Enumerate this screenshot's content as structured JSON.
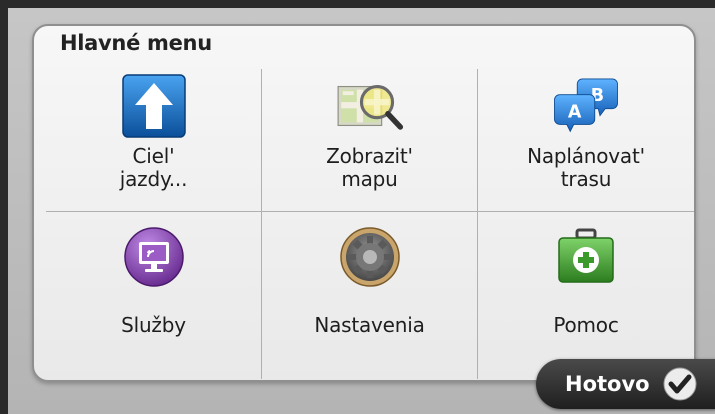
{
  "title": "Hlavné menu",
  "menu": {
    "items": [
      {
        "label1": "Ciel'",
        "label2": "jazdy...",
        "icon": "arrow-up-icon"
      },
      {
        "label1": "Zobrazit'",
        "label2": "mapu",
        "icon": "map-magnifier-icon"
      },
      {
        "label1": "Naplánovat'",
        "label2": "trasu",
        "icon": "route-ab-icon"
      },
      {
        "label1": "Služby",
        "label2": "",
        "icon": "services-monitor-icon"
      },
      {
        "label1": "Nastavenia",
        "label2": "",
        "icon": "settings-gear-icon"
      },
      {
        "label1": "Pomoc",
        "label2": "",
        "icon": "help-medkit-icon"
      }
    ]
  },
  "footer": {
    "done_label": "Hotovo",
    "done_icon": "checkmark-icon"
  },
  "colors": {
    "accent_blue": "#1f6fc0",
    "accent_purple": "#7a3fa3",
    "accent_green": "#3d9a2c",
    "done_button": "#2b2b2b"
  }
}
